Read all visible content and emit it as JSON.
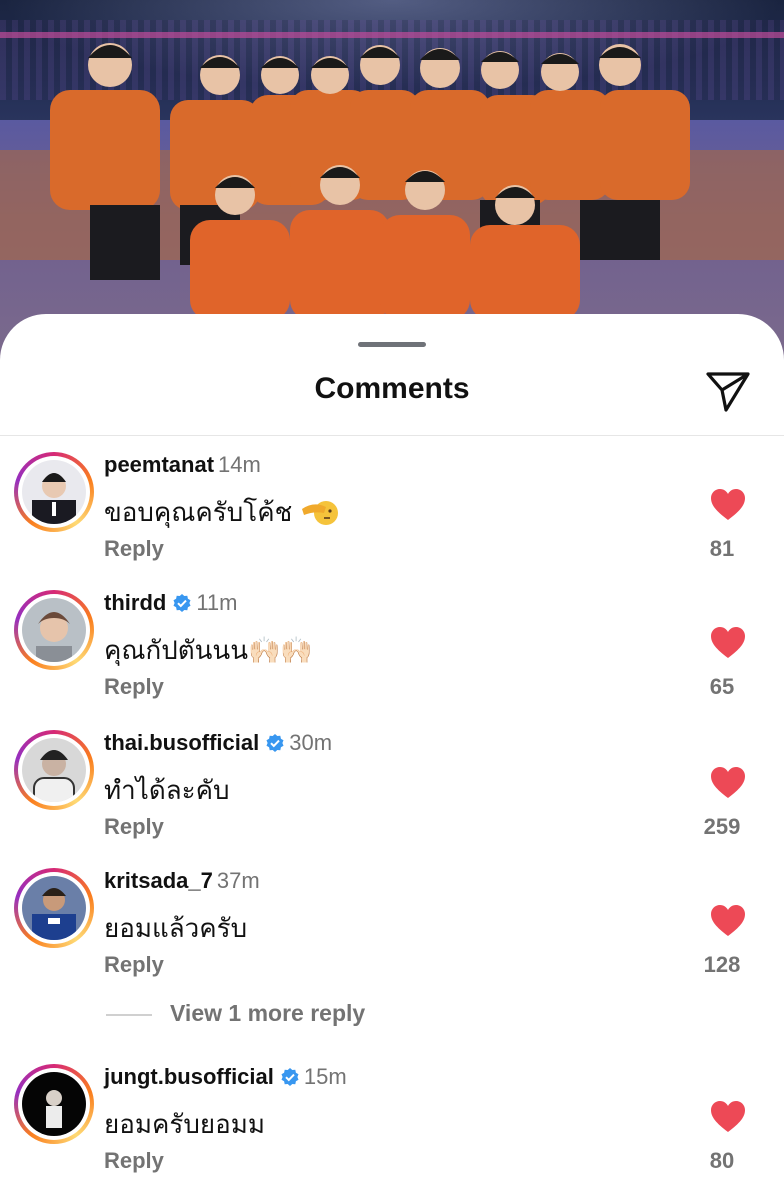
{
  "header": {
    "title": "Comments",
    "send_icon": "paper-plane-icon"
  },
  "colors": {
    "accent_heart": "#ed4956",
    "verified": "#3897f0",
    "muted_text": "#737373"
  },
  "comments": [
    {
      "username": "peemtanat",
      "time": "14m",
      "verified": false,
      "text": "ขอบคุณครับโค้ช",
      "emoji": "saluting-face",
      "reply": "Reply",
      "likes": "81"
    },
    {
      "username": "thirdd",
      "time": "11m",
      "verified": true,
      "text": "คุณกัปตันนน🙌🏻🙌🏻",
      "reply": "Reply",
      "likes": "65"
    },
    {
      "username": "thai.busofficial",
      "time": "30m",
      "verified": true,
      "text": "ทำได้ละคับ",
      "reply": "Reply",
      "likes": "259"
    },
    {
      "username": "kritsada_7",
      "time": "37m",
      "verified": false,
      "text": "ยอมแล้วครับ",
      "reply": "Reply",
      "likes": "128"
    },
    {
      "username": "jungt.busofficial",
      "time": "15m",
      "verified": true,
      "text": "ยอมครับยอมม",
      "reply": "Reply",
      "likes": "80"
    }
  ],
  "view_more": "View 1 more reply"
}
